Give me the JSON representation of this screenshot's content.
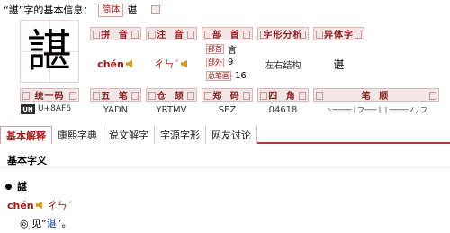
{
  "header": {
    "quote_open": "“",
    "char": "諶",
    "quote_close": "”",
    "suffix": "字的基本信息：",
    "simplified_tag": "简体",
    "simplified_char": "谌"
  },
  "big_char": "諶",
  "info": {
    "pinyin_label": "拼 音",
    "pinyin": "chén",
    "zhuyin_label": "注 音",
    "zhuyin": "ㄔㄣˊ",
    "bushou_label": "部 首",
    "bushou_rows": [
      {
        "label": "部首",
        "value": "言"
      },
      {
        "label": "部外",
        "value": "9"
      },
      {
        "label": "总笔画",
        "value": "16"
      }
    ],
    "structure_label": "字形分析",
    "structure": "左右结构",
    "variant_label": "异体字",
    "variant": "谌",
    "unicode_label": "统一码",
    "unicode_icon": "UN",
    "unicode": "U+8AF6",
    "wubi_label": "五 笔",
    "wubi": "YADN",
    "cangjie_label": "仓 颉",
    "cangjie": "YRTMV",
    "zhengma_label": "郑 码",
    "zhengma": "SEZ",
    "sijiao_label": "四 角",
    "sijiao": "04618",
    "bishun_label": "笔 顺",
    "bishun": "丶一一一丨フ一一丨丨一一一ノ丿フ"
  },
  "tabs": [
    "基本解释",
    "康熙字典",
    "说文解字",
    "字源字形",
    "网友讨论"
  ],
  "section_title": "基本字义",
  "entry": {
    "char": "諶",
    "pinyin": "chén",
    "zhuyin": "ㄔㄣˊ",
    "definition_prefix": "◎ 见",
    "definition_open": "“",
    "definition_ref": "谌",
    "definition_close": "”。"
  },
  "colors": {
    "accent": "#b53636",
    "header_bg": "#f3e6e6"
  }
}
